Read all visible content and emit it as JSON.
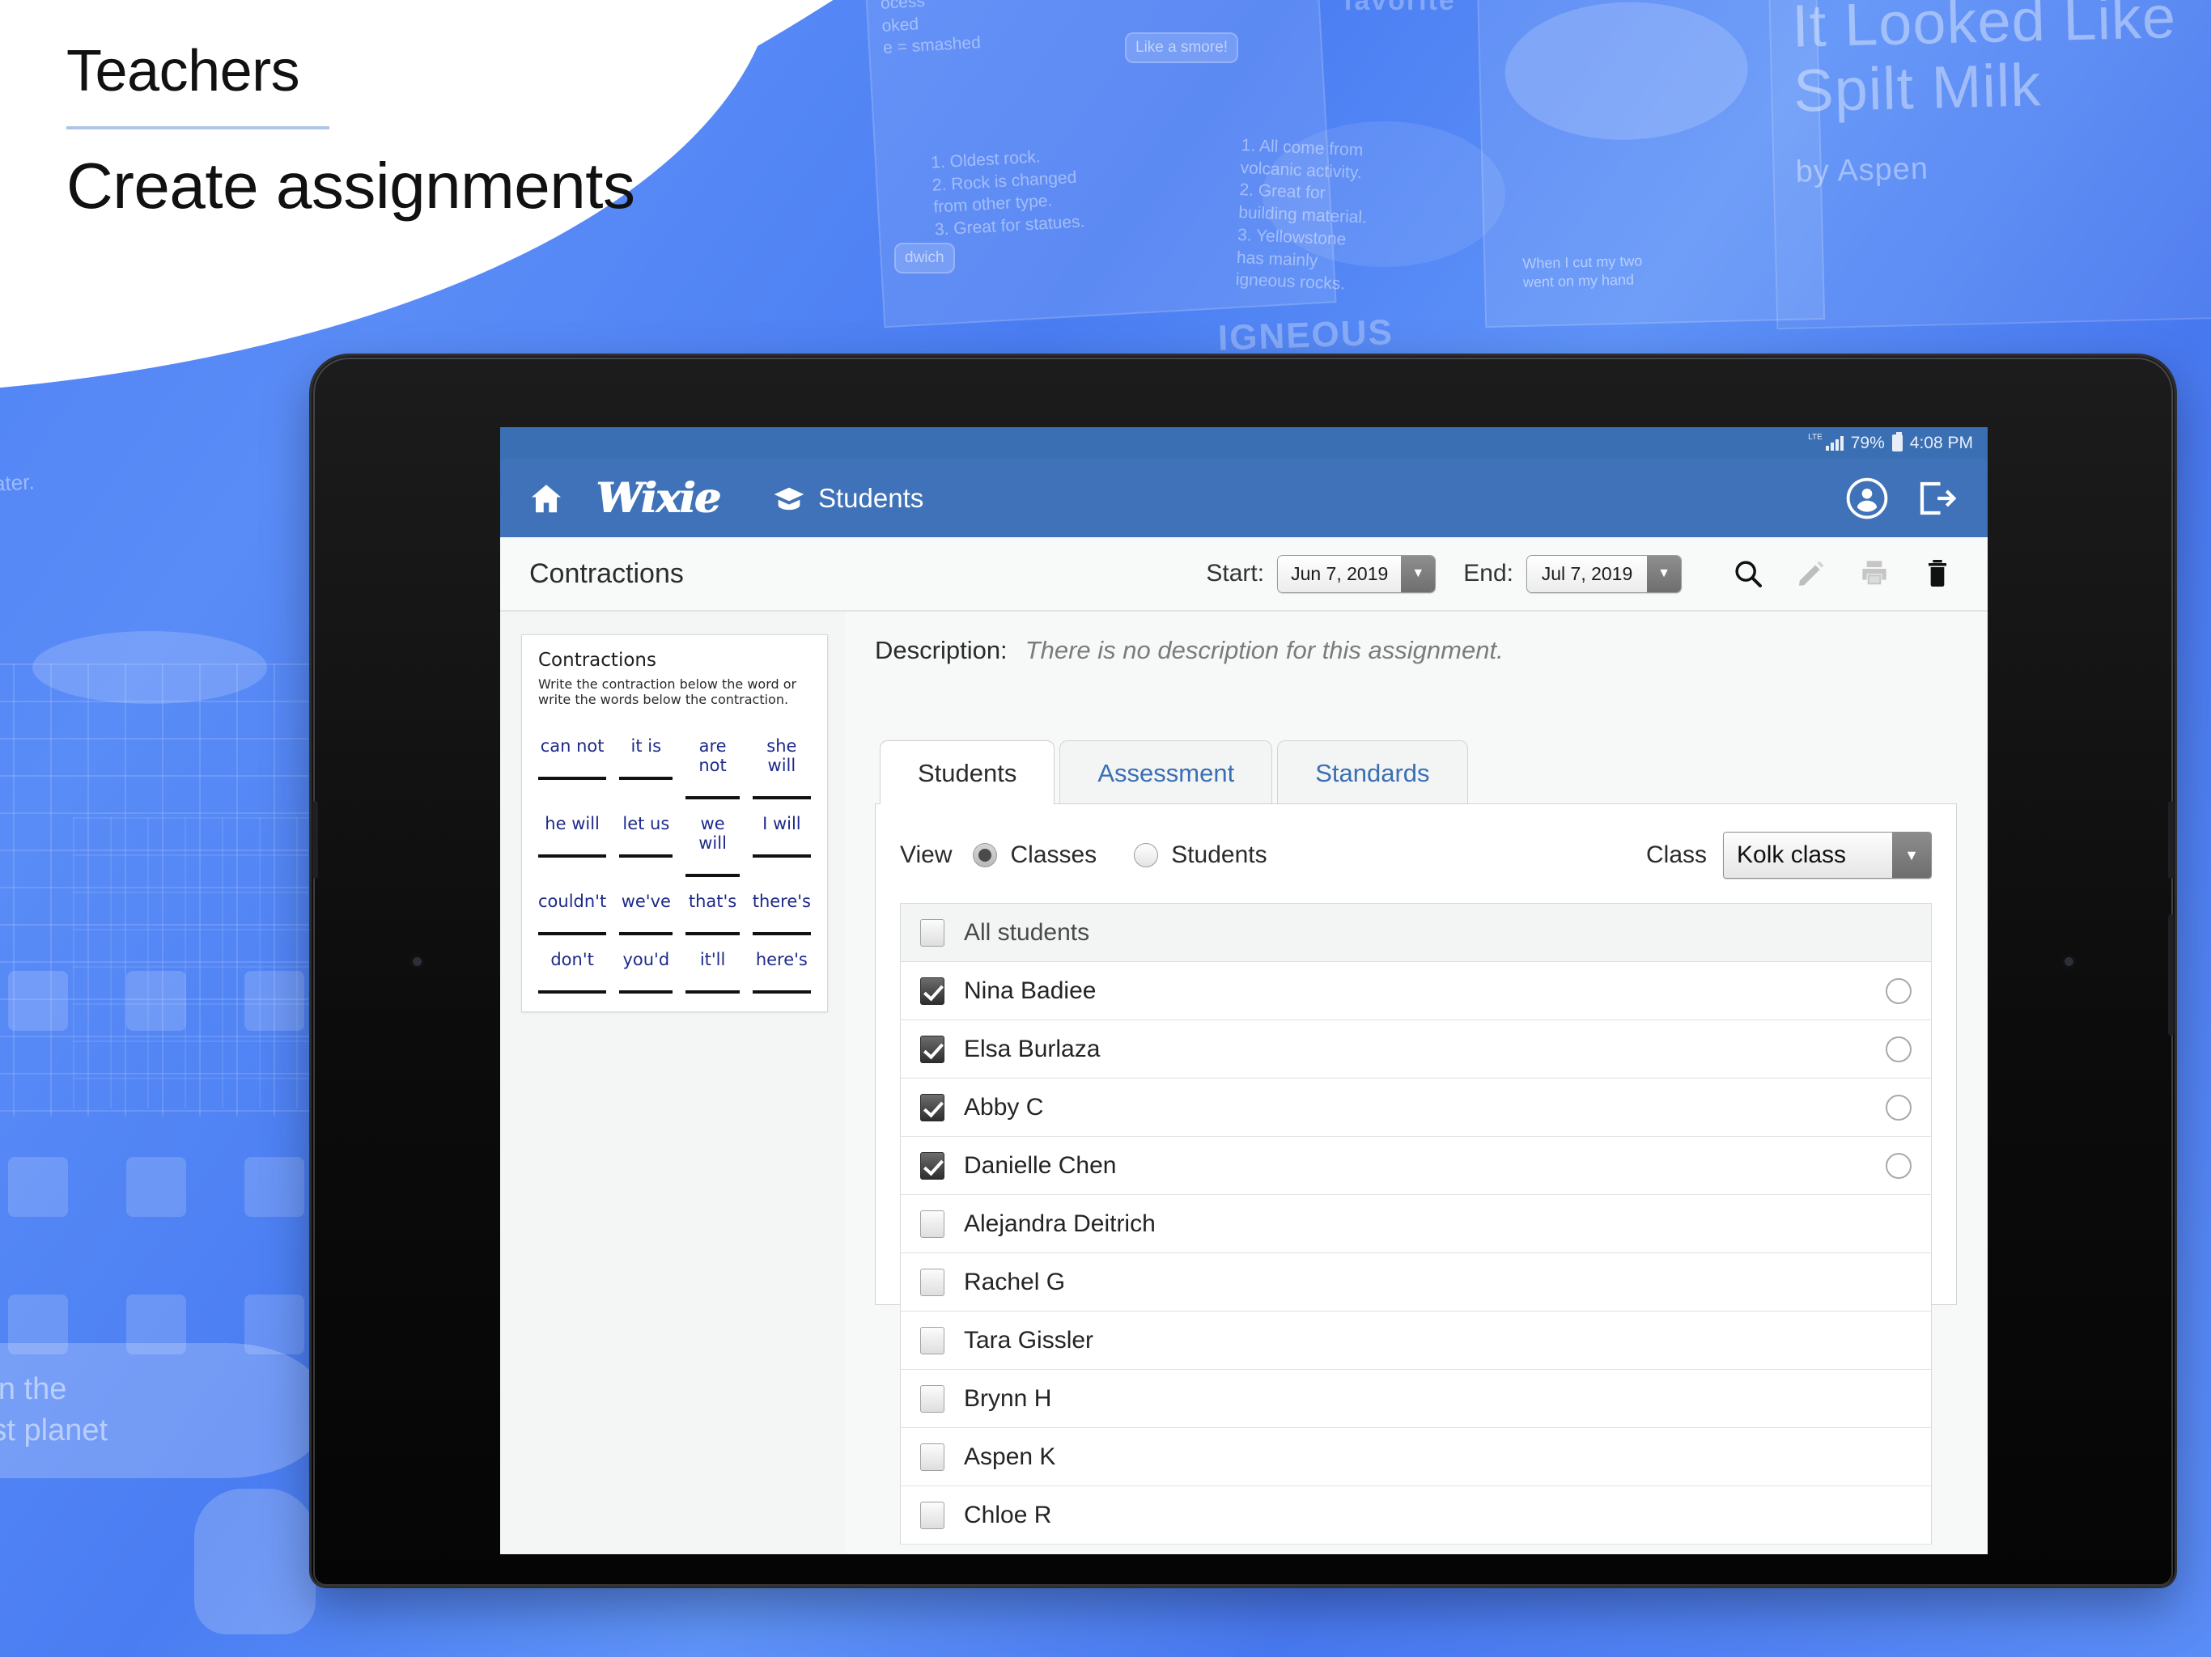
{
  "headline": {
    "eyebrow": "Teachers",
    "title": "Create assignments"
  },
  "background": {
    "cards": [
      {
        "title": "It Looked Like",
        "title2": "Spilt Milk",
        "byline": "by Aspen"
      },
      {
        "lines": [
          "ocess",
          "oked",
          "e = smashed"
        ]
      },
      {
        "lines": [
          "1. Oldest rock.",
          "2. Rock is changed",
          "from other type.",
          "3. Great for statues."
        ]
      },
      {
        "lines": [
          "1. All come from",
          "volcanic activity.",
          "2. Great for",
          "building material.",
          "3. Yellowstone",
          "has mainly",
          "igneous rocks."
        ]
      }
    ],
    "bubbles": [
      "Like a smore!",
      "dwich"
    ],
    "words": [
      "IGNEOUS",
      "favorite"
    ],
    "fragments": [
      "water.",
      "elf on the",
      "ngest planet",
      "When I cut my two",
      "went on my hand"
    ]
  },
  "statusbar": {
    "network": "LTE",
    "battery_pct": "79%",
    "time": "4:08 PM"
  },
  "appbar": {
    "home_icon": "home-icon",
    "logo": "Wixie",
    "nav_icon": "graduation-cap-icon",
    "nav_label": "Students",
    "account_icon": "account-circle-icon",
    "logout_icon": "logout-icon"
  },
  "toolbar": {
    "assignment_title": "Contractions",
    "start_label": "Start:",
    "start_date": "Jun 7, 2019",
    "end_label": "End:",
    "end_date": "Jul 7, 2019",
    "icons": [
      "search-icon",
      "edit-pencil-icon",
      "print-icon",
      "delete-trash-icon"
    ]
  },
  "worksheet": {
    "title": "Contractions",
    "instructions": "Write the contraction below the word or write the words below the contraction.",
    "rows": [
      [
        "can not",
        "it is",
        "are not",
        "she will"
      ],
      [
        "he will",
        "let us",
        "we will",
        "I will"
      ],
      [
        "couldn't",
        "we've",
        "that's",
        "there's"
      ],
      [
        "don't",
        "you'd",
        "it'll",
        "here's"
      ]
    ]
  },
  "description": {
    "label": "Description:",
    "value": "There is no description for this assignment."
  },
  "tabs": [
    {
      "label": "Students",
      "active": true
    },
    {
      "label": "Assessment",
      "active": false
    },
    {
      "label": "Standards",
      "active": false
    }
  ],
  "view_controls": {
    "view_label": "View",
    "option_classes": "Classes",
    "option_students": "Students",
    "selected": "Classes",
    "class_label": "Class",
    "class_value": "Kolk class"
  },
  "student_list": {
    "header_label": "All students",
    "header_checked": false,
    "students": [
      {
        "name": "Nina Badiee",
        "checked": true,
        "has_status": true
      },
      {
        "name": "Elsa Burlaza",
        "checked": true,
        "has_status": true
      },
      {
        "name": "Abby C",
        "checked": true,
        "has_status": true
      },
      {
        "name": "Danielle Chen",
        "checked": true,
        "has_status": true
      },
      {
        "name": "Alejandra Deitrich",
        "checked": false,
        "has_status": false
      },
      {
        "name": "Rachel G",
        "checked": false,
        "has_status": false
      },
      {
        "name": "Tara Gissler",
        "checked": false,
        "has_status": false
      },
      {
        "name": "Brynn H",
        "checked": false,
        "has_status": false
      },
      {
        "name": "Aspen K",
        "checked": false,
        "has_status": false
      },
      {
        "name": "Chloe R",
        "checked": false,
        "has_status": false
      }
    ]
  },
  "colors": {
    "brand_blue": "#3f72b8",
    "statusbar_blue": "#3a6fb4",
    "tab_link": "#3a6fb4",
    "worksheet_ink": "#1d2a8a",
    "bg_blue": "#4f82f5"
  }
}
